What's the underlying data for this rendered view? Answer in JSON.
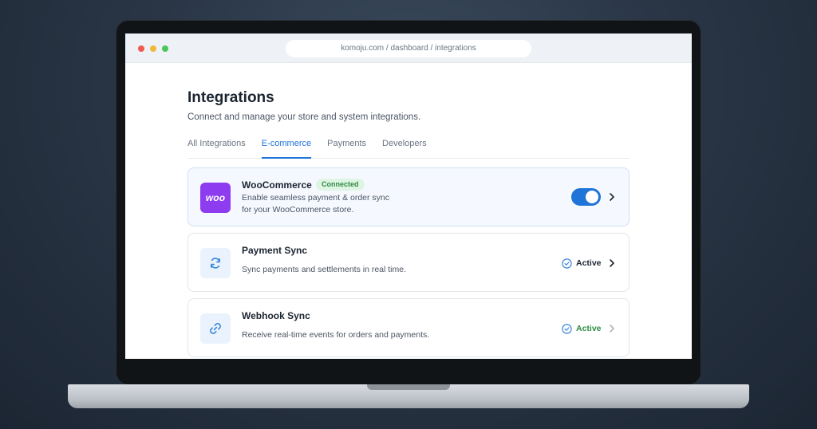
{
  "browser": {
    "url": "komoju.com / dashboard / integrations"
  },
  "page": {
    "title": "Integrations",
    "subtitle": "Connect and manage your store and system integrations."
  },
  "tabs": [
    {
      "label": "All Integrations",
      "active": false
    },
    {
      "label": "E-commerce",
      "active": true
    },
    {
      "label": "Payments",
      "active": false
    },
    {
      "label": "Developers",
      "active": false
    }
  ],
  "integrations": [
    {
      "name": "WooCommerce",
      "logo_text": "woo",
      "badge": "Connected",
      "description_line1": "Enable seamless payment & order sync",
      "description_line2": "for your WooCommerce store.",
      "enabled": true
    },
    {
      "name": "Payment Sync",
      "icon": "refresh-icon",
      "description": "Sync payments and settlements in real time.",
      "status": "Active"
    },
    {
      "name": "Webhook Sync",
      "icon": "link-icon",
      "description": "Receive real-time events for orders and payments.",
      "status": "Active"
    }
  ],
  "colors": {
    "accent": "#1f74d8",
    "woo_purple": "#8e3cf0",
    "active_green": "#2f8a43",
    "active_dark": "#1b2430"
  }
}
